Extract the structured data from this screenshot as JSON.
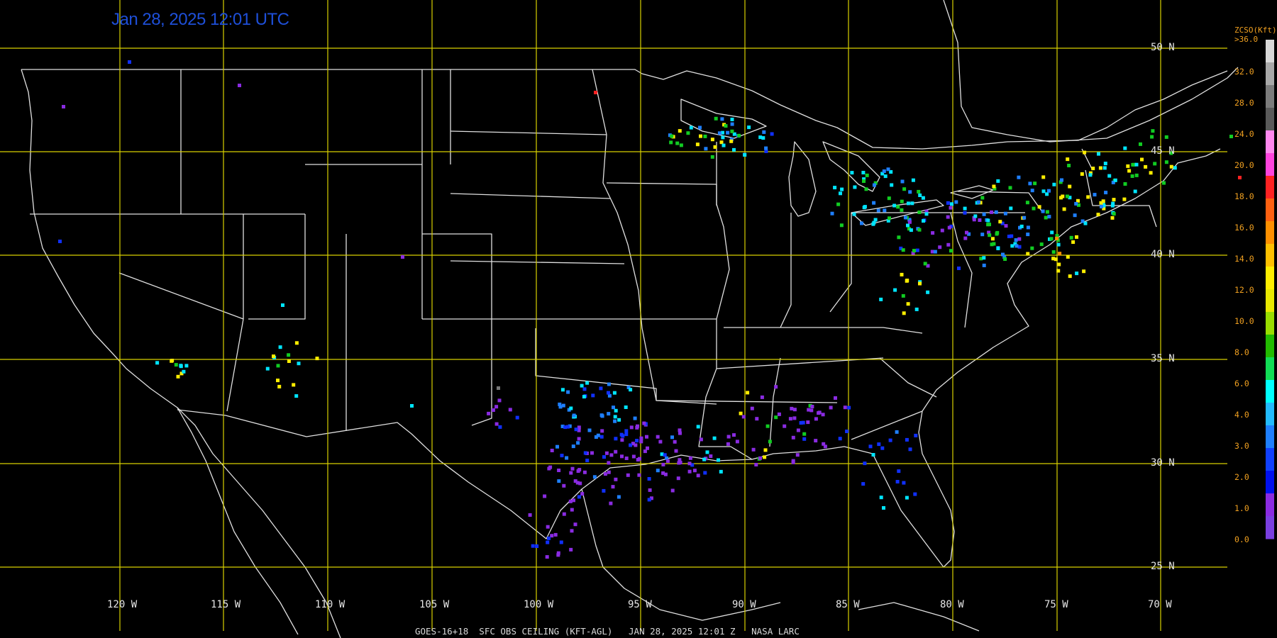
{
  "header": {
    "timestamp": "Jan 28, 2025 12:01 UTC"
  },
  "footer": {
    "caption": "GOES-16+18  SFC OBS CEILING (KFT-AGL)   JAN 28, 2025 12:01 Z   NASA LARC"
  },
  "grid": {
    "latitudes": [
      "50 N",
      "45 N",
      "40 N",
      "35 N",
      "30 N",
      "25 N"
    ],
    "longitudes": [
      "120 W",
      "115 W",
      "110 W",
      "105 W",
      "100 W",
      "95 W",
      "90 W",
      "85 W",
      "80 W",
      "75 W",
      "70 W"
    ]
  },
  "legend": {
    "title": "ZCSO(Kft)",
    "top_label": ">36.0",
    "ticks": [
      "32.0",
      "28.0",
      "24.0",
      "20.0",
      "18.0",
      "16.0",
      "14.0",
      "12.0",
      "10.0",
      "8.0",
      "6.0",
      "4.0",
      "3.0",
      "2.0",
      "1.0",
      "0.0"
    ],
    "colors": [
      "#d8d8d8",
      "#a8a8a8",
      "#7c7c7c",
      "#5a5a5a",
      "#ff88ee",
      "#ff44dd",
      "#ff2222",
      "#ff6010",
      "#ff9000",
      "#ffc000",
      "#ffee00",
      "#e8e800",
      "#99dd00",
      "#22bb00",
      "#11dd55",
      "#00ffff",
      "#22bbff",
      "#1e7fff",
      "#1040ff",
      "#0010ee",
      "#8a2be2",
      "#7a3fe0"
    ]
  },
  "colors": {
    "grid_line": "#d8d000",
    "boundary": "#e0e0e0",
    "background": "#000000",
    "title": "#1e4fd8",
    "legend_text": "#f0a020"
  }
}
